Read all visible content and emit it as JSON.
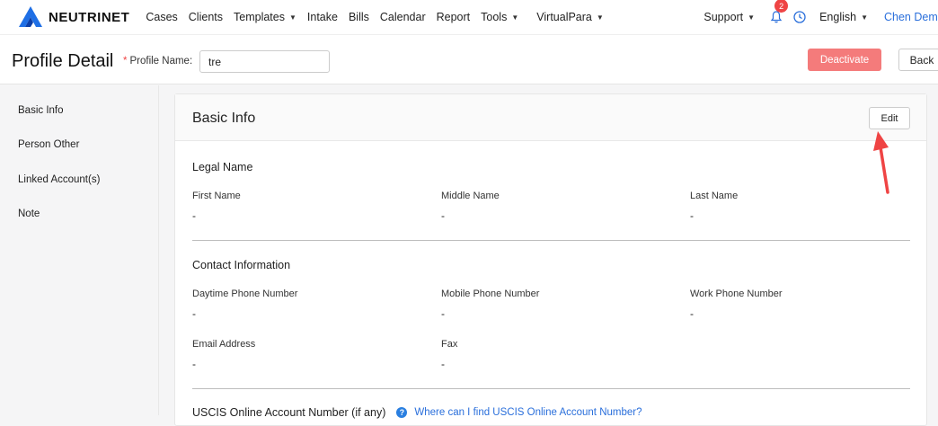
{
  "nav": {
    "brand": "NEUTRINET",
    "items": [
      {
        "label": "Cases",
        "dropdown": false
      },
      {
        "label": "Clients",
        "dropdown": false
      },
      {
        "label": "Templates",
        "dropdown": true
      },
      {
        "label": "Intake",
        "dropdown": false
      },
      {
        "label": "Bills",
        "dropdown": false
      },
      {
        "label": "Calendar",
        "dropdown": false
      },
      {
        "label": "Report",
        "dropdown": false
      },
      {
        "label": "Tools",
        "dropdown": true
      },
      {
        "label": "VirtualPara",
        "dropdown": true
      }
    ],
    "support": "Support",
    "notification_count": "2",
    "language": "English",
    "user": "Chen Demo",
    "accent_color": "#2a6fdb"
  },
  "header": {
    "title": "Profile Detail",
    "profile_name_label": "Profile Name:",
    "profile_name_required": "*",
    "profile_name_value": "tre",
    "deactivate_label": "Deactivate",
    "back_label": "Back"
  },
  "sidebar": {
    "items": [
      {
        "label": "Basic Info"
      },
      {
        "label": "Person Other"
      },
      {
        "label": "Linked Account(s)"
      },
      {
        "label": "Note"
      }
    ]
  },
  "card": {
    "title": "Basic Info",
    "edit_label": "Edit",
    "legal_name": {
      "title": "Legal Name",
      "fields": [
        {
          "label": "First Name",
          "value": "-"
        },
        {
          "label": "Middle Name",
          "value": "-"
        },
        {
          "label": "Last Name",
          "value": "-"
        }
      ]
    },
    "contact": {
      "title": "Contact Information",
      "fields": [
        {
          "label": "Daytime Phone Number",
          "value": "-"
        },
        {
          "label": "Mobile Phone Number",
          "value": "-"
        },
        {
          "label": "Work Phone Number",
          "value": "-"
        },
        {
          "label": "Email Address",
          "value": "-"
        },
        {
          "label": "Fax",
          "value": "-"
        }
      ]
    },
    "uscis": {
      "label": "USCIS Online Account Number (if any)",
      "help_link": "Where can I find USCIS Online Account Number?"
    }
  },
  "icons": {
    "logo": "neutrinet-logo-icon",
    "bell": "bell-icon",
    "clock": "clock-icon",
    "help": "question-icon",
    "annotation": "red-arrow-icon"
  },
  "colors": {
    "danger": "#f47b7b",
    "badge": "#ef4444",
    "arrow": "#ef4444"
  }
}
